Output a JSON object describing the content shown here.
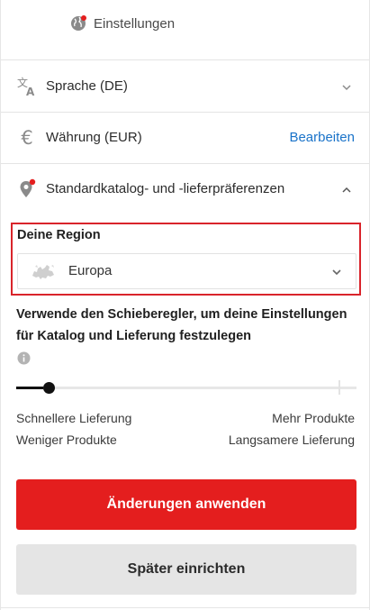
{
  "header": {
    "title": "Einstellungen",
    "icon": "globe-icon",
    "badge_color": "#e41e1e"
  },
  "rows": [
    {
      "icon": "translate-icon",
      "label": "Sprache (DE)"
    },
    {
      "icon": "euro-icon",
      "label": "Währung (EUR)",
      "action": "Bearbeiten"
    },
    {
      "icon": "location-pin-icon",
      "label": "Standardkatalog- und -lieferpräferenzen"
    }
  ],
  "region": {
    "heading": "Deine Region",
    "selected": "Europa",
    "highlight_color": "#d9242b"
  },
  "slider": {
    "description": "Verwende den Schieberegler, um deine Einstellungen für Katalog und Lieferung festzulegen",
    "value_fraction": 0.05,
    "left_label_1": "Schnellere Lieferung",
    "left_label_2": "Weniger Produkte",
    "right_label_1": "Mehr Produkte",
    "right_label_2": "Langsamere Lieferung"
  },
  "buttons": {
    "apply": "Änderungen anwenden",
    "later": "Später einrichten"
  },
  "colors": {
    "accent": "#e41e1e",
    "link": "#1a73c9"
  }
}
